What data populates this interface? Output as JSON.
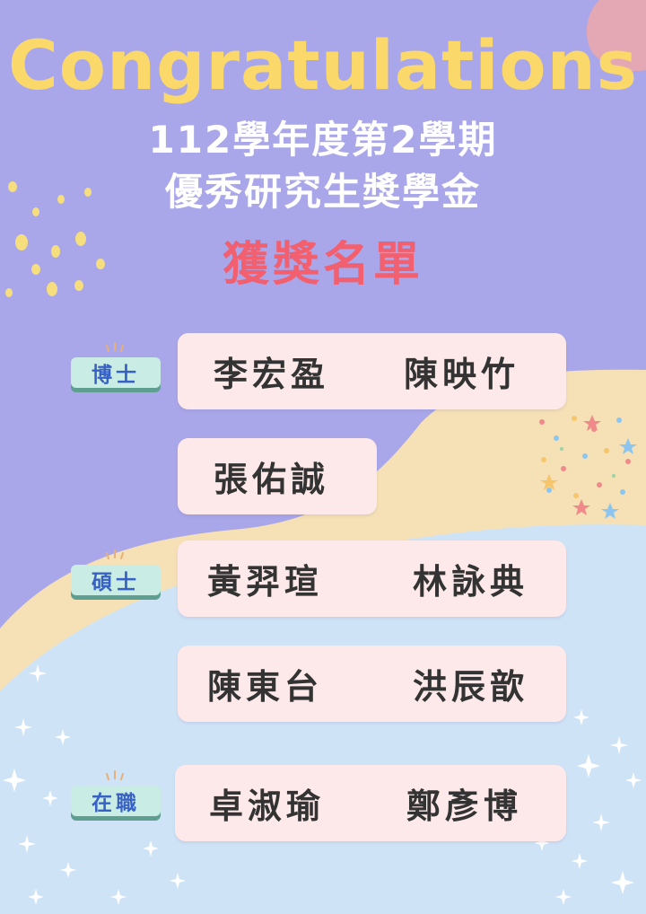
{
  "title": "Congratulations",
  "subtitle_line1": "112學年度第2學期",
  "subtitle_line2": "優秀研究生獎學金",
  "heading": "獲獎名單",
  "colors": {
    "background_purple": "#a9a7ea",
    "background_cream": "#f6e1b6",
    "background_blue": "#cfe3f7",
    "title_yellow": "#fbd86a",
    "heading_red": "#f25f6e",
    "card_pink": "#fde9e9",
    "tag_mint": "#c9ece4",
    "tag_text_blue": "#3761c4"
  },
  "groups": [
    {
      "label": "博士",
      "rows": [
        [
          "李宏盈",
          "陳映竹"
        ],
        [
          "張佑誠"
        ]
      ]
    },
    {
      "label": "碩士",
      "rows": [
        [
          "黃羿瑄",
          "林詠典"
        ],
        [
          "陳東台",
          "洪辰歆"
        ]
      ]
    },
    {
      "label": "在職",
      "rows": [
        [
          "卓淑瑜",
          "鄭彥博"
        ]
      ]
    }
  ]
}
